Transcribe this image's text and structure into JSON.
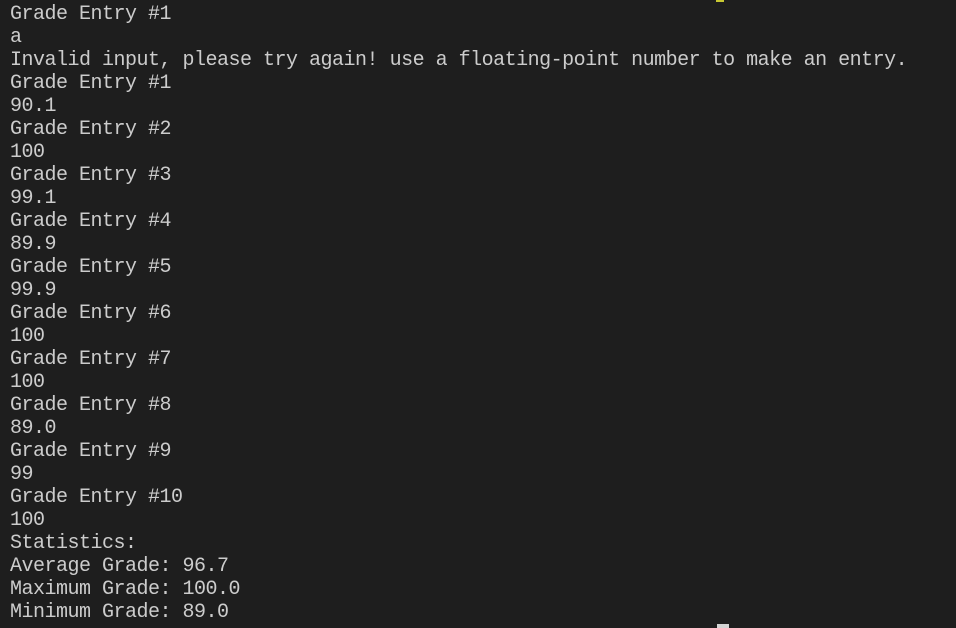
{
  "terminal": {
    "lines": [
      "Grade Entry #1",
      "a",
      "Invalid input, please try again! use a floating-point number to make an entry.",
      "Grade Entry #1",
      "90.1",
      "Grade Entry #2",
      "100",
      "Grade Entry #3",
      "99.1",
      "Grade Entry #4",
      "89.9",
      "Grade Entry #5",
      "99.9",
      "Grade Entry #6",
      "100",
      "Grade Entry #7",
      "100",
      "Grade Entry #8",
      "89.0",
      "Grade Entry #9",
      "99",
      "Grade Entry #10",
      "100",
      "Statistics:",
      "Average Grade: 96.7",
      "Maximum Grade: 100.0",
      "Minimum Grade: 89.0"
    ]
  },
  "colors": {
    "background": "#1e1e1e",
    "text": "#cccccc",
    "cursor": "#d4d4d4"
  }
}
